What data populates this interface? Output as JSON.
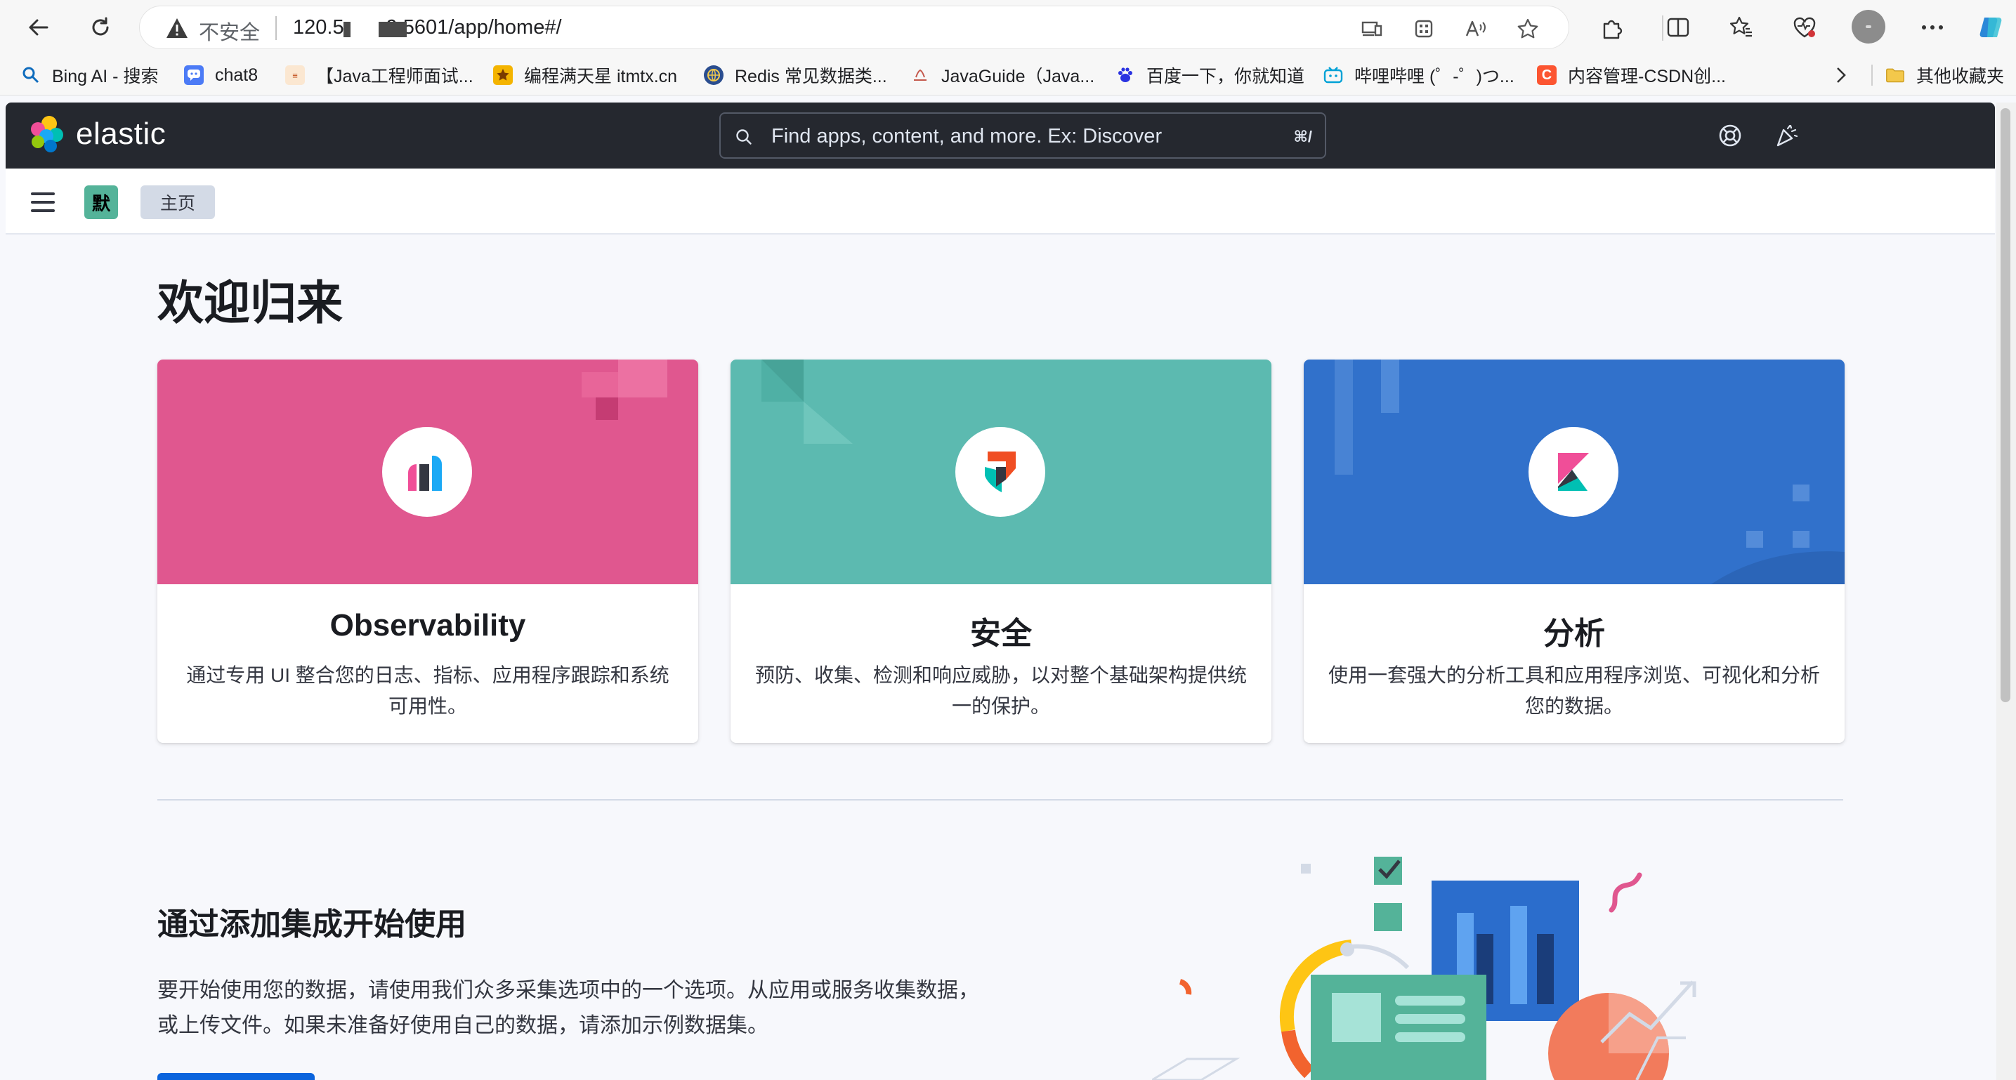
{
  "browser": {
    "security_label": "不安全",
    "url_prefix": "120.5",
    "url_suffix": "9:5601/app/home#/"
  },
  "bookmarks": [
    {
      "label": "Bing AI - 搜索",
      "icon": "bing-search-icon"
    },
    {
      "label": "chat8",
      "icon": "chat-icon"
    },
    {
      "label": "【Java工程师面试...",
      "icon": "site-favicon"
    },
    {
      "label": "编程满天星 itmtx.cn",
      "icon": "star-favicon"
    },
    {
      "label": "Redis 常见数据类...",
      "icon": "globe-favicon"
    },
    {
      "label": "JavaGuide（Java...",
      "icon": "javaguide-favicon"
    },
    {
      "label": "百度一下，你就知道",
      "icon": "baidu-icon"
    },
    {
      "label": "哔哩哔哩 (゜-゜)つ...",
      "icon": "bilibili-icon"
    },
    {
      "label": "内容管理-CSDN创...",
      "icon": "csdn-icon"
    }
  ],
  "bookmarks_more_label": "其他收藏夹",
  "kibana": {
    "brand": "elastic",
    "search_placeholder": "Find apps, content, and more. Ex: Discover",
    "search_shortcut": "⌘/",
    "space_initial": "默",
    "breadcrumb": "主页"
  },
  "home": {
    "title": "欢迎归来",
    "solutions": [
      {
        "title": "Observability",
        "description": "通过专用 UI 整合您的日志、指标、应用程序跟踪和系统可用性。",
        "color": "#e0578f"
      },
      {
        "title": "安全",
        "description": "预防、收集、检测和响应威胁，以对整个基础架构提供统一的保护。",
        "color": "#5cbab0"
      },
      {
        "title": "分析",
        "description": "使用一套强大的分析工具和应用程序浏览、可视化和分析您的数据。",
        "color": "#3171cb"
      }
    ],
    "integrations": {
      "title": "通过添加集成开始使用",
      "description": "要开始使用您的数据，请使用我们众多采集选项中的一个选项。从应用或服务收集数据，或上传文件。如果未准备好使用自己的数据，请添加示例数据集。"
    }
  },
  "colors": {
    "header_bg": "#25282f",
    "accent": "#0b64dd",
    "space_badge": "#54b399"
  }
}
